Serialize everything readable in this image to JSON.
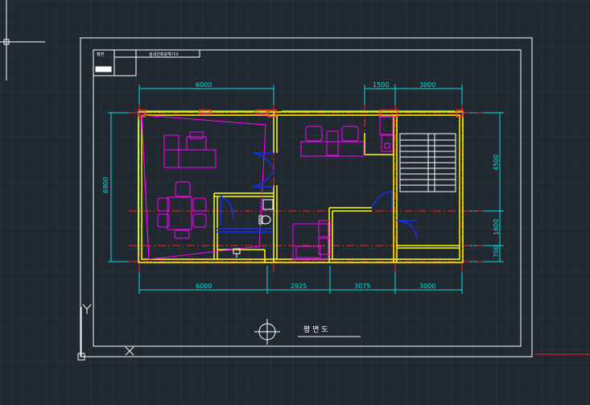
{
  "title_block": {
    "row1": "평면\n도",
    "label": "실내건축설계기사"
  },
  "dimensions": {
    "top": [
      "6000",
      "1500",
      "3000"
    ],
    "bottom": [
      "6000",
      "2925",
      "3075",
      "3000"
    ],
    "left": "6900",
    "right": [
      "4500",
      "1600",
      "700"
    ]
  },
  "drawing_title": "평 면 도",
  "colors": {
    "background": "#212830",
    "grid": "#2a3440",
    "border": "#ffffff",
    "dim": "#00e5e5",
    "wall": "#ffff00",
    "furniture": "#ff00ff",
    "door": "#0000ff",
    "window": "#00ff00",
    "center": "#ff0000",
    "stair": "#ffffff"
  }
}
